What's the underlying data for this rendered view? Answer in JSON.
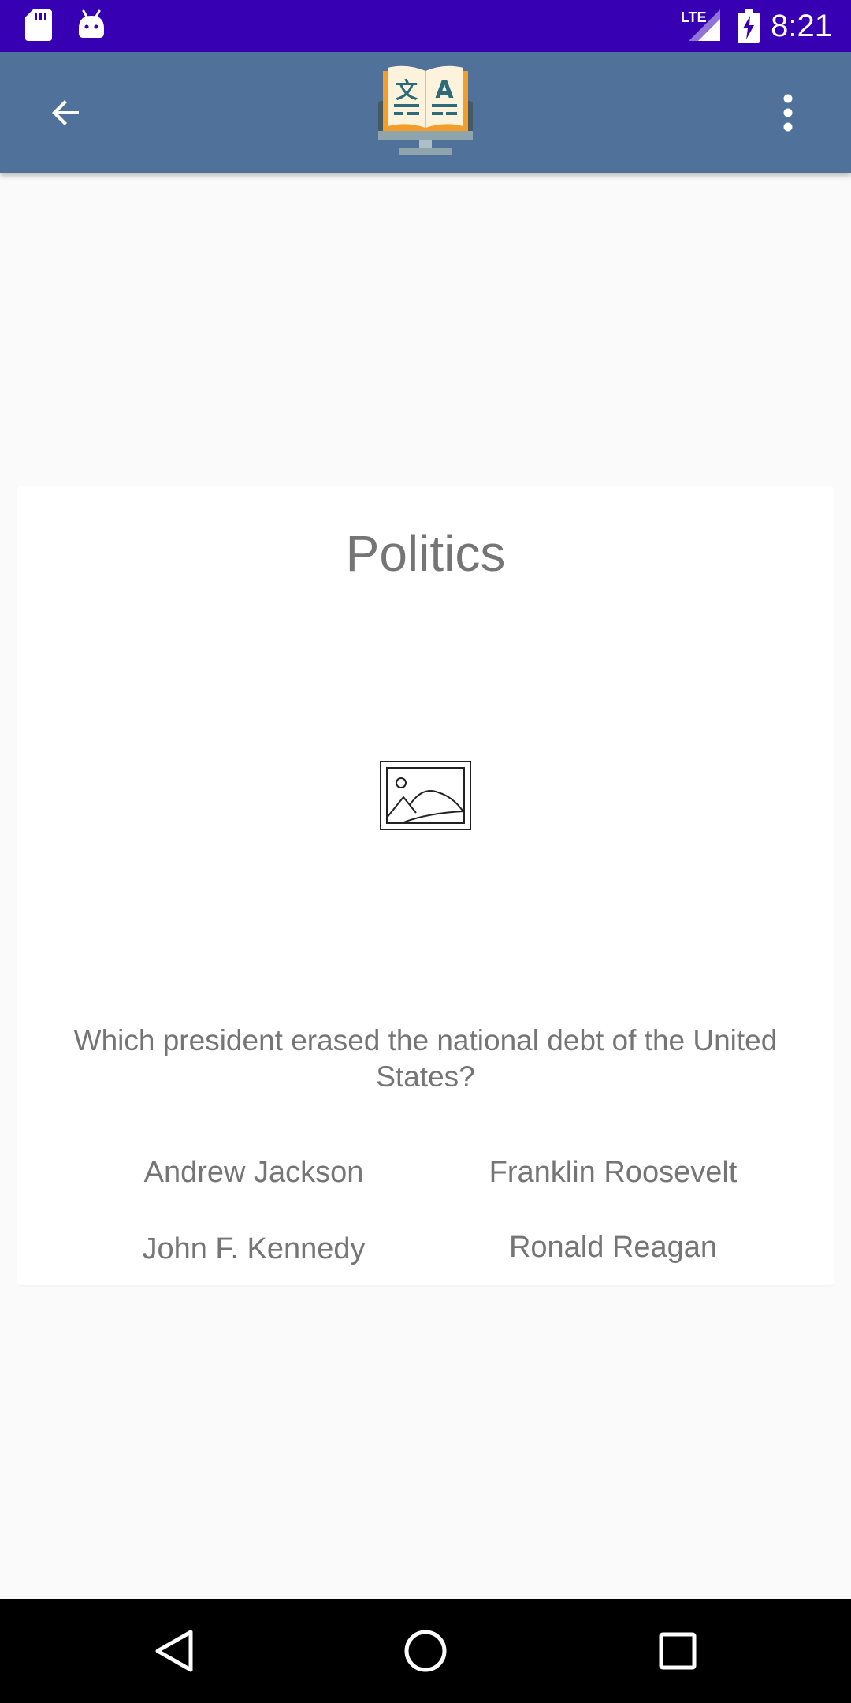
{
  "status_bar": {
    "time": "8:21",
    "network_label": "LTE",
    "icons": [
      "sd-card-icon",
      "android-icon",
      "signal-icon",
      "battery-charging-icon"
    ],
    "background_color": "#3700b3"
  },
  "app_bar": {
    "back_icon": "arrow-back-icon",
    "logo_icon": "book-monitor-logo",
    "logo_text_left": "文",
    "logo_text_right": "A",
    "menu_icon": "more-vert-icon",
    "background_color": "#4f719a"
  },
  "question_card": {
    "category": "Politics",
    "image_icon": "image-placeholder-icon",
    "question": "Which president erased the national debt of the United States?",
    "answers": [
      "Andrew Jackson",
      "Franklin Roosevelt",
      "John F. Kennedy",
      "Ronald Reagan"
    ]
  },
  "nav_bar": {
    "icons": [
      "nav-back-icon",
      "nav-home-icon",
      "nav-recents-icon"
    ]
  }
}
